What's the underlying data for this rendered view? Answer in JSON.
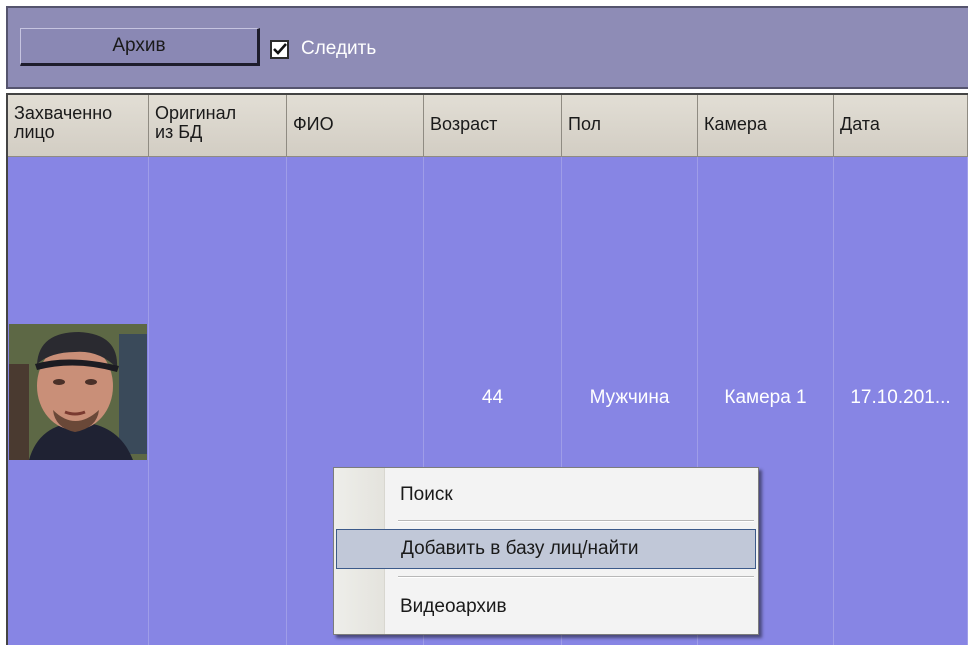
{
  "toolbar": {
    "archive_label": "Архив",
    "follow_label": "Следить",
    "follow_checked": true
  },
  "table": {
    "columns": [
      {
        "line1": "Захваченно",
        "line2": "лицо"
      },
      {
        "line1": "Оригинал",
        "line2": "из БД"
      },
      {
        "line1": "ФИО",
        "line2": ""
      },
      {
        "line1": "Возраст",
        "line2": ""
      },
      {
        "line1": "Пол",
        "line2": ""
      },
      {
        "line1": "Камера",
        "line2": ""
      },
      {
        "line1": "Дата",
        "line2": ""
      }
    ],
    "row": {
      "fio": "",
      "age": "44",
      "gender": "Мужчина",
      "camera": "Камера 1",
      "date": "17.10.201..."
    }
  },
  "context_menu": {
    "items": [
      {
        "label": "Поиск",
        "highlighted": false
      },
      {
        "label": "Добавить в базу лиц/найти",
        "highlighted": true
      },
      {
        "label": "Видеоархив",
        "highlighted": false
      }
    ]
  },
  "colors": {
    "toolbar_bg": "#8e8cb6",
    "row_selected_bg": "#8785e4",
    "menu_highlight": "#c1c8d8"
  }
}
